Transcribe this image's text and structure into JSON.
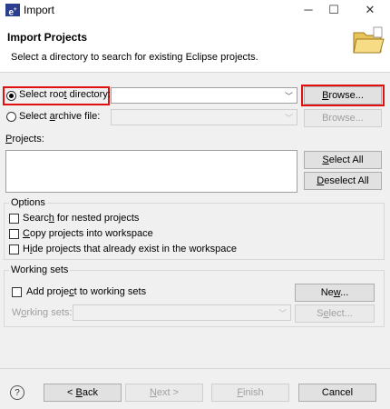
{
  "window": {
    "title": "Import",
    "app_icon": "eclipse-icon",
    "minimize": "─",
    "maximize": "☐",
    "close": "✕"
  },
  "header": {
    "title": "Import Projects",
    "description": "Select a directory to search for existing Eclipse projects.",
    "icon": "folder-icon"
  },
  "root_directory": {
    "label_pre": "Select roo",
    "label_u": "t",
    "label_post": " directory:",
    "selected": true,
    "value": "",
    "browse_pre": "",
    "browse_u": "B",
    "browse_post": "rowse..."
  },
  "archive_file": {
    "label_pre": "Select ",
    "label_u": "a",
    "label_post": "rchive file:",
    "selected": false,
    "value": "",
    "browse": "Browse..."
  },
  "projects": {
    "label_u": "P",
    "label_post": "rojects:",
    "select_all_u": "S",
    "select_all_post": "elect All",
    "deselect_all_u": "D",
    "deselect_all_post": "eselect All"
  },
  "options": {
    "title": "Options",
    "nested": {
      "pre": "Searc",
      "u": "h",
      "post": " for nested projects",
      "checked": false
    },
    "copy": {
      "pre": "",
      "u": "C",
      "post": "opy projects into workspace",
      "checked": false
    },
    "hide": {
      "pre": "H",
      "u": "i",
      "post": "de projects that already exist in the workspace",
      "checked": false
    }
  },
  "working_sets": {
    "title": "Working sets",
    "add": {
      "pre": "Add proje",
      "u": "c",
      "post": "t to working sets",
      "checked": false
    },
    "new_pre": "Ne",
    "new_u": "w",
    "new_post": "...",
    "label_pre": "W",
    "label_u": "o",
    "label_post": "rking sets:",
    "select_pre": "S",
    "select_u": "e",
    "select_post": "lect..."
  },
  "footer": {
    "help": "?",
    "back_pre": "< ",
    "back_u": "B",
    "back_post": "ack",
    "next_u": "N",
    "next_post": "ext >",
    "finish_u": "F",
    "finish_post": "inish",
    "cancel": "Cancel"
  }
}
